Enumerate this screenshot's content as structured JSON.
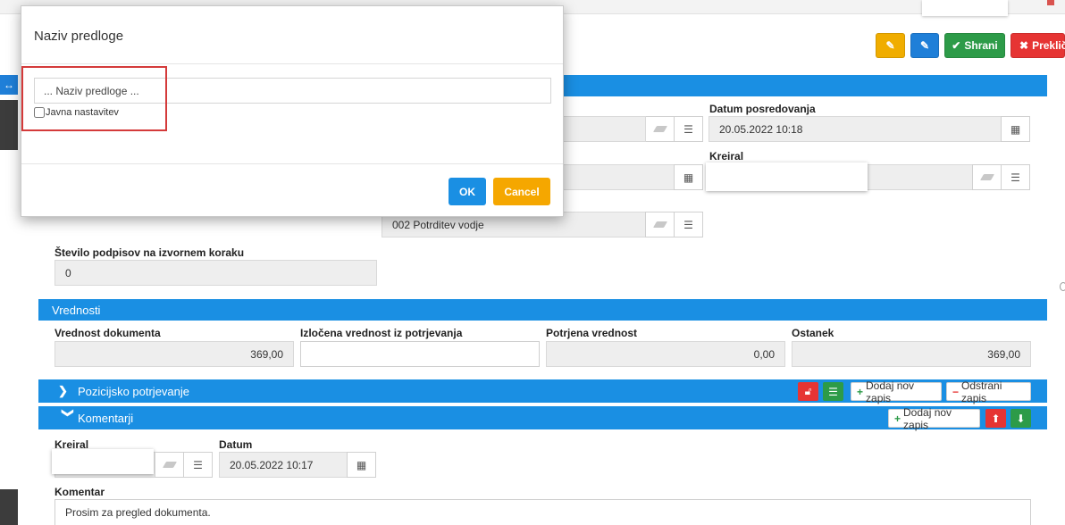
{
  "header": {
    "save_label": "Shrani",
    "cancel_label": "Prekliči",
    "colors": {
      "yellow": "#f0ad00",
      "blue": "#1f7fd8",
      "green": "#2d9b48",
      "red": "#e63433"
    }
  },
  "main": {
    "datum_posredovanja": {
      "label": "Datum posredovanja",
      "value": "20.05.2022 10:18"
    },
    "kreiral": {
      "label": "Kreiral"
    },
    "step_value": "002 Potrditev vodje",
    "stevilo_podpisov": {
      "label": "Število podpisov na izvornem koraku",
      "value": "0"
    }
  },
  "vrednosti": {
    "title": "Vrednosti",
    "vrednost_dokumenta": {
      "label": "Vrednost dokumenta",
      "value": "369,00"
    },
    "izlocena": {
      "label": "Izločena vrednost iz potrjevanja",
      "value": ""
    },
    "potrjena": {
      "label": "Potrjena vrednost",
      "value": "0,00"
    },
    "ostanek": {
      "label": "Ostanek",
      "value": "369,00"
    }
  },
  "pozicijsko": {
    "title": "Pozicijsko potrjevanje",
    "add_label": "Dodaj nov zapis",
    "remove_label": "Odstrani zapis"
  },
  "komentarji": {
    "title": "Komentarji",
    "add_label": "Dodaj nov zapis",
    "kreiral_label": "Kreiral",
    "datum_label": "Datum",
    "datum_value": "20.05.2022 10:17",
    "komentar_label": "Komentar",
    "komentar_value": "Prosim za pregled dokumenta."
  },
  "modal": {
    "title": "Naziv predloge",
    "input_placeholder": "... Naziv predloge ...",
    "checkbox_label": "Javna nastavitev",
    "ok_label": "OK",
    "cancel_label": "Cancel"
  }
}
